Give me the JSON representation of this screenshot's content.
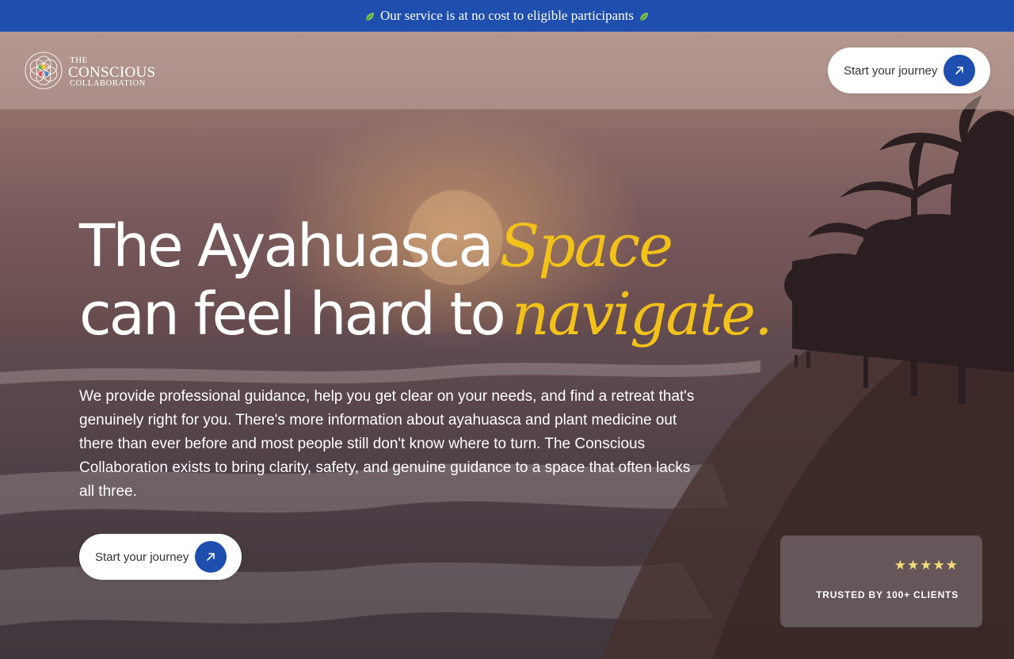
{
  "banner": {
    "text": "Our service is at no cost to eligible participants",
    "icon": "leaf-icon"
  },
  "header": {
    "logo": {
      "the": "THE",
      "conscious": "CONSCIOUS",
      "collaboration": "COLLABORATION"
    },
    "cta_label": "Start your journey"
  },
  "hero": {
    "headline_line1_plain": "The Ayahuasca",
    "headline_line1_accent": "Space",
    "headline_line2_plain": "can feel hard to",
    "headline_line2_accent": "navigate.",
    "body": "We provide professional guidance, help you get clear on your needs, and find a retreat that's genuinely right for you. There's more information about ayahuasca and plant medicine out there than ever before and most people still don't know where to turn. The Conscious Collaboration exists to bring clarity, safety, and genuine guidance to a space that often lacks all three.",
    "cta_label": "Start your journey"
  },
  "trust": {
    "stars": "★★★★★",
    "rating": 5,
    "label": "TRUSTED BY 100+ CLIENTS"
  },
  "colors": {
    "brand_blue": "#1e4fae",
    "accent_yellow": "#f2c21b",
    "star_yellow": "#f5dc7a"
  }
}
